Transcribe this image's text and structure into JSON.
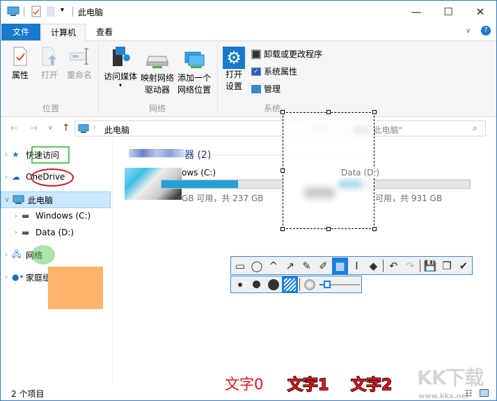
{
  "window": {
    "title": "此电脑",
    "minimize": "—",
    "maximize": "☐",
    "close": "✕"
  },
  "tabs": [
    {
      "label": "文件"
    },
    {
      "label": "计算机"
    },
    {
      "label": "查看"
    }
  ],
  "ribbon": {
    "location": {
      "label": "位置",
      "buttons": [
        "属性",
        "打开",
        "重命名"
      ]
    },
    "network": {
      "label": "网络",
      "buttons": [
        "访问媒体",
        "映射网络\n驱动器",
        "添加一个\n网络位置"
      ],
      "map_line1": "映射网络",
      "map_line2": "驱动器",
      "add_line1": "添加一个",
      "add_line2": "网络位置"
    },
    "system": {
      "label": "系统",
      "open_line1": "打开",
      "open_line2": "设置",
      "items": [
        "卸载或更改程序",
        "系统属性",
        "管理"
      ]
    }
  },
  "address": {
    "path": "此电脑",
    "search_placeholder": "搜索\"此电脑\""
  },
  "nav": [
    {
      "label": "快速访问"
    },
    {
      "label": "OneDrive"
    },
    {
      "label": "此电脑"
    },
    {
      "label": "Windows (C:)"
    },
    {
      "label": "Data (D:)"
    },
    {
      "label": "网络"
    },
    {
      "label": "家庭组"
    }
  ],
  "content": {
    "group_header": "器 (2)",
    "drives": [
      {
        "name": "ows (C:)",
        "space": "GB 可用，共 237 GB",
        "used_fraction": 0.63
      },
      {
        "name": "Data (D:)",
        "space": "可用，共 931 GB",
        "used_fraction": 0.17
      }
    ]
  },
  "status": {
    "items": "2 个项目"
  },
  "annotations": {
    "texts": [
      "文字0",
      "文字1",
      "文字2"
    ],
    "red": "#e0141e",
    "green": "#5cc85c",
    "orange": "#ffb36b"
  },
  "watermark": {
    "logo": "KK下载",
    "url": "www.kkx.net"
  }
}
